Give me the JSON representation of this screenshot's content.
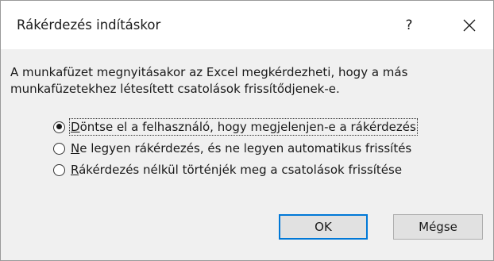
{
  "dialog": {
    "title": "Rákérdezés indításkor",
    "help_label": "?"
  },
  "description": "A munkafüzet megnyitásakor az Excel megkérdezheti, hogy a más munkafüzetekhez létesített csatolások frissítődjenek-e.",
  "options": [
    {
      "accel": "D",
      "rest": "öntse el a felhasználó, hogy megjelenjen-e a rákérdezés",
      "checked": true
    },
    {
      "accel": "N",
      "rest": "e legyen rákérdezés, és ne legyen automatikus frissítés",
      "checked": false
    },
    {
      "accel": "R",
      "rest": "ákérdezés nélkül történjék meg a csatolások frissítése",
      "checked": false
    }
  ],
  "buttons": {
    "ok": "OK",
    "cancel": "Mégse"
  },
  "colors": {
    "accent": "#0078d7",
    "body_bg": "#f0f0f0"
  }
}
